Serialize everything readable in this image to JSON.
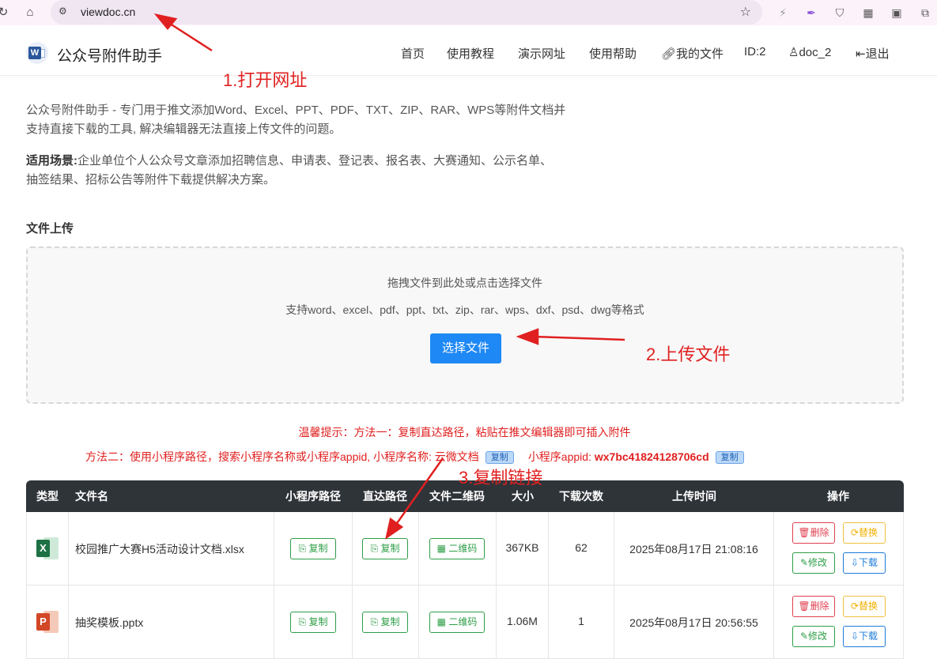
{
  "browser": {
    "url": "viewdoc.cn",
    "icons": [
      "reload-icon",
      "home-icon",
      "site-info-icon",
      "bookmark-star-icon",
      "lightning-extension-icon",
      "feather-extension-icon",
      "shield-extension-icon",
      "qr-extension-icon",
      "tab-extension-icon",
      "puzzle-extension-icon"
    ]
  },
  "header": {
    "brand": "公众号附件助手",
    "logo_letter": "W",
    "nav": [
      "首页",
      "使用教程",
      "演示网址",
      "使用帮助",
      "我的文件",
      "ID:2",
      "doc_2",
      "退出"
    ]
  },
  "intro": {
    "line1": "公众号附件助手 - 专门用于推文添加Word、Excel、PPT、PDF、TXT、ZIP、RAR、WPS等附件文档并",
    "line2": "支持直接下载的工具, 解决编辑器无法直接上传文件的问题。",
    "scene_label": "适用场景:",
    "scene_line1": "企业单位个人公众号文章添加招聘信息、申请表、登记表、报名表、大赛通知、公示名单、",
    "scene_line2": "抽签结果、招标公告等附件下载提供解决方案。"
  },
  "upload": {
    "section_title": "文件上传",
    "drop_text": "拖拽文件到此处或点击选择文件",
    "formats_text": "支持word、excel、pdf、ppt、txt、zip、rar、wps、dxf、psd、dwg等格式",
    "choose_button": "选择文件"
  },
  "tips": {
    "tip1": "温馨提示：方法一：复制直达路径，粘贴在推文编辑器即可插入附件",
    "tip2_prefix": "方法二：使用小程序路径，搜索小程序名称或小程序appid, 小程序名称: 云微文档",
    "copy_label": "复制",
    "appid_label": "小程序appid: ",
    "appid": "wx7bc41824128706cd"
  },
  "table": {
    "headers": [
      "类型",
      "文件名",
      "小程序路径",
      "直达路径",
      "文件二维码",
      "大小",
      "下载次数",
      "上传时间",
      "操作"
    ],
    "rows": [
      {
        "type_icon": "excel-icon",
        "type_letter": "X",
        "filename": "校园推广大赛H5活动设计文档.xlsx",
        "mini_path_btn": "复制",
        "direct_path_btn": "复制",
        "qrcode_btn": "二维码",
        "size": "367KB",
        "downloads": "62",
        "upload_time": "2025年08月17日 21:08:16",
        "actions": {
          "delete": "删除",
          "replace": "替换",
          "edit": "修改",
          "download": "下载"
        }
      },
      {
        "type_icon": "powerpoint-icon",
        "type_letter": "P",
        "filename": "抽奖模板.pptx",
        "mini_path_btn": "复制",
        "direct_path_btn": "复制",
        "qrcode_btn": "二维码",
        "size": "1.06M",
        "downloads": "1",
        "upload_time": "2025年08月17日 20:56:55",
        "actions": {
          "delete": "删除",
          "replace": "替换",
          "edit": "修改",
          "download": "下载"
        }
      }
    ]
  },
  "annotations": {
    "step1": "1.打开网址",
    "step2": "2.上传文件",
    "step3": "3.复制链接",
    "color": "#e02020"
  },
  "colors": {
    "primary_button": "#1e88f5",
    "table_header": "#2f3439",
    "excel": "#1e7145",
    "powerpoint": "#d24726"
  }
}
